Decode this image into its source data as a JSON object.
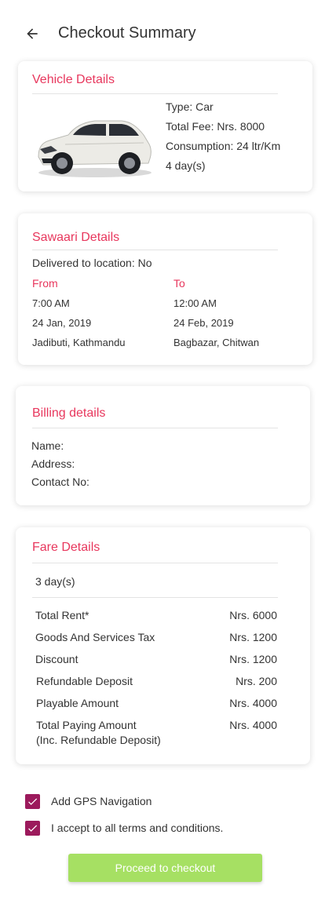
{
  "header": {
    "title": "Checkout Summary",
    "back_icon": "arrow-left-icon"
  },
  "vehicle": {
    "title": "Vehicle Details",
    "type": "Type: Car",
    "total_fee": "Total Fee: Nrs. 8000",
    "consumption": "Consumption: 24 ltr/Km",
    "duration": "4 day(s)"
  },
  "sawaari": {
    "title": "Sawaari Details",
    "delivered": "Delivered to location: No",
    "from_label": "From",
    "to_label": "To",
    "from_time": "7:00 AM",
    "from_date": "24 Jan, 2019",
    "from_place": "Jadibuti, Kathmandu",
    "to_time": "12:00 AM",
    "to_date": "24 Feb, 2019",
    "to_place": "Bagbazar, Chitwan"
  },
  "billing": {
    "title": "Billing details",
    "name_label": "Name:",
    "address_label": "Address:",
    "contact_label": "Contact No:"
  },
  "fare": {
    "title": "Fare Details",
    "duration": "3 day(s)",
    "rows": [
      {
        "label": "Total Rent*",
        "value": "Nrs. 6000"
      },
      {
        "label": "Goods And Services Tax",
        "value": "Nrs. 1200"
      },
      {
        "label": "Discount",
        "value": "Nrs. 1200"
      },
      {
        "label": "Refundable Deposit",
        "value": "Nrs. 200"
      },
      {
        "label": "Playable Amount",
        "value": "Nrs. 4000"
      },
      {
        "label": "Total Paying Amount",
        "value": "Nrs. 4000"
      }
    ],
    "total_note": "(Inc. Refundable Deposit)"
  },
  "options": {
    "gps_label": "Add GPS Navigation",
    "gps_checked": true,
    "terms_label": "I accept to all terms and conditions.",
    "terms_checked": true
  },
  "proceed_label": "Proceed to checkout",
  "colors": {
    "accent": "#e8375d",
    "checkbox": "#9c1a5c",
    "button": "#a6e063"
  }
}
